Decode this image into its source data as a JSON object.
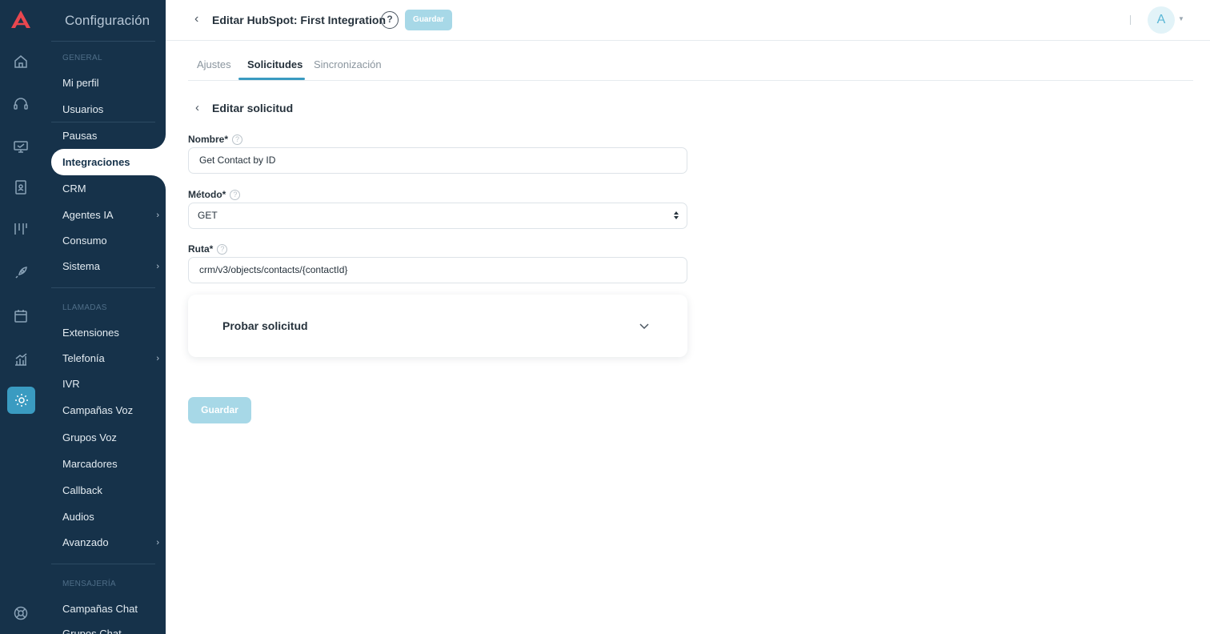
{
  "header": {
    "title": "Editar HubSpot: First Integration",
    "help": "?",
    "save_label": "Guardar",
    "avatar_initial": "A"
  },
  "rail_icons": [
    "home-icon",
    "headset-icon",
    "monitor-icon",
    "contacts-book-icon",
    "kanban-icon",
    "rocket-icon",
    "calendar-icon",
    "analytics-icon",
    "settings-icon",
    "support-icon"
  ],
  "sidebar": {
    "title": "Configuración",
    "sections": {
      "general": "GENERAL",
      "llamadas": "LLAMADAS",
      "mensajeria": "MENSAJERÍA"
    },
    "items": {
      "mi_perfil": "Mi perfil",
      "usuarios": "Usuarios",
      "pausas": "Pausas",
      "integraciones": "Integraciones",
      "crm": "CRM",
      "agentes_ia": "Agentes IA",
      "consumo": "Consumo",
      "sistema": "Sistema",
      "extensiones": "Extensiones",
      "telefonia": "Telefonía",
      "ivr": "IVR",
      "campanas_voz": "Campañas Voz",
      "grupos_voz": "Grupos Voz",
      "marcadores": "Marcadores",
      "callback": "Callback",
      "audios": "Audios",
      "avanzado": "Avanzado",
      "campanas_chat": "Campañas Chat",
      "grupos_chat": "Grupos Chat"
    },
    "active_item": "Integraciones"
  },
  "tabs": [
    "Ajustes",
    "Solicitudes",
    "Sincronización"
  ],
  "active_tab": "Solicitudes",
  "form": {
    "title": "Editar solicitud",
    "nombre_label": "Nombre*",
    "nombre_value": "Get Contact by ID",
    "metodo_label": "Método*",
    "metodo_value": "GET",
    "ruta_label": "Ruta*",
    "ruta_value": "crm/v3/objects/contacts/{contactId}",
    "test_title": "Probar solicitud",
    "save_label": "Guardar",
    "help_glyph": "?"
  },
  "colors": {
    "sidebar_bg": "#16324a",
    "accent": "#3a9bc1",
    "disabled_button": "#a7d8e7"
  }
}
